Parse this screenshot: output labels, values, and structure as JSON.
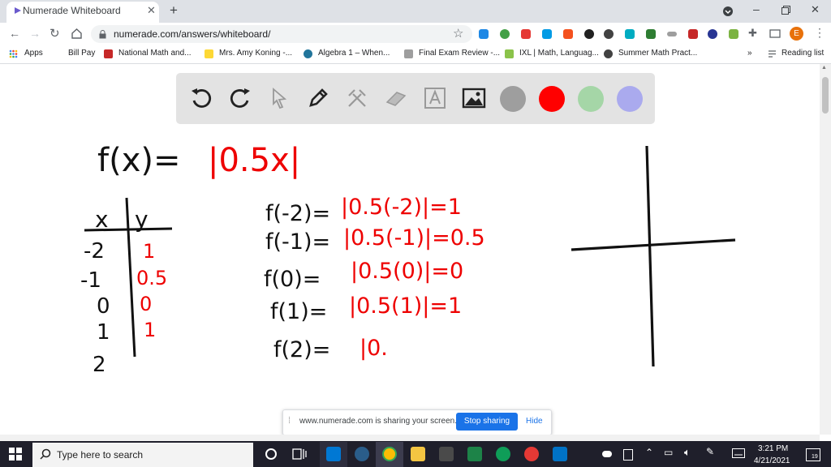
{
  "browser": {
    "tab_title": "Numerade Whiteboard",
    "new_tab": "+",
    "url": "numerade.com/answers/whiteboard/",
    "profile_initial": "E",
    "bookmarks": [
      "Apps",
      "Bill Pay",
      "National Math and...",
      "Mrs. Amy Koning -...",
      "Algebra 1 – When...",
      "Final Exam Review -...",
      "IXL | Math, Languag...",
      "Summer Math Pract...",
      "»",
      "Reading list"
    ]
  },
  "whiteboard": {
    "tools": [
      "undo-icon",
      "redo-icon",
      "pointer-icon",
      "pen-icon",
      "tools-icon",
      "eraser-icon",
      "text-icon",
      "image-icon"
    ],
    "colors": [
      "#9e9e9e",
      "#ff0000",
      "#a5d6a7",
      "#aaaaee"
    ],
    "handwriting": {
      "function_prefix": "f(x)=",
      "function_body": "|0.5x|",
      "table_header_x": "x",
      "table_header_y": "y",
      "table_x": [
        "-2",
        "-1",
        "0",
        "1",
        "2"
      ],
      "table_y": [
        "1",
        "0.5",
        "0",
        "1"
      ],
      "eval_lhs": [
        "f(-2)=",
        "f(-1)=",
        "f(0)=",
        "f(1)=",
        "f(2)="
      ],
      "eval_rhs": [
        "|0.5(-2)|=1",
        "|0.5(-1)|=0.5",
        "|0.5(0)|=0",
        "|0.5(1)|=1",
        "|0."
      ]
    }
  },
  "share_bar": {
    "message": "www.numerade.com is sharing your screen.",
    "stop": "Stop sharing",
    "hide": "Hide"
  },
  "taskbar": {
    "search_placeholder": "Type here to search",
    "time": "3:21 PM",
    "date": "4/21/2021",
    "notification_count": "19"
  }
}
